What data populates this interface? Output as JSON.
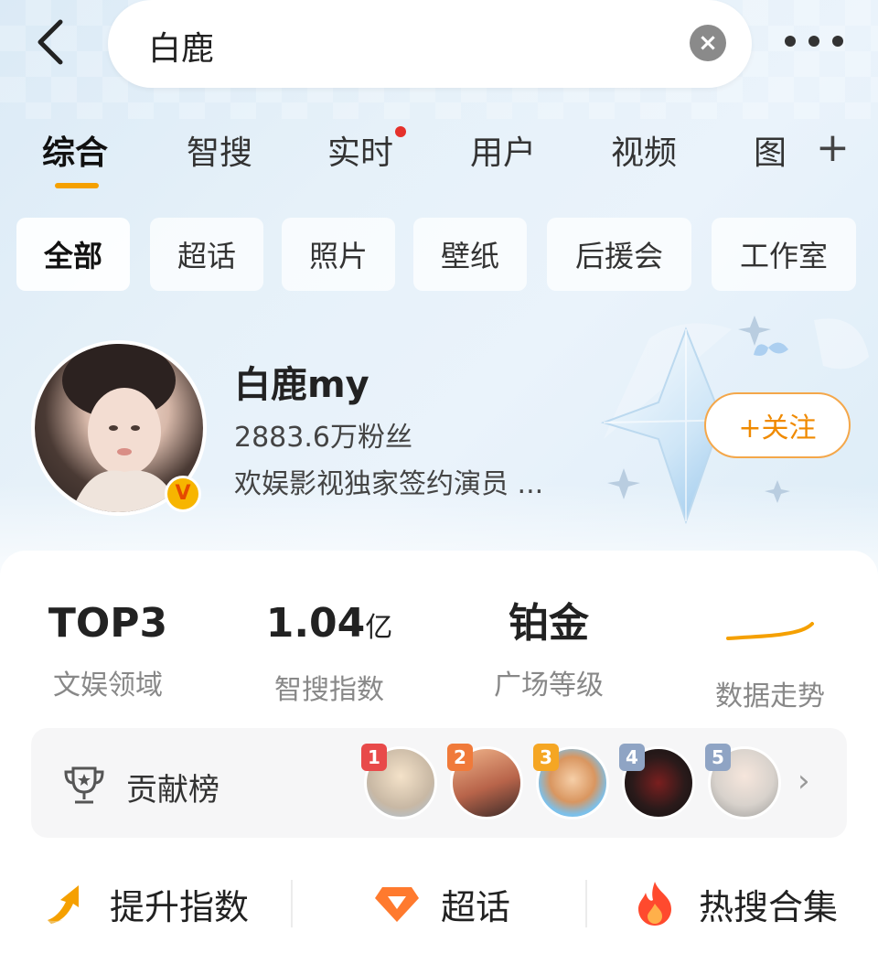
{
  "search": {
    "query": "白鹿",
    "clear_label": "×"
  },
  "tabs": [
    {
      "label": "综合"
    },
    {
      "label": "智搜"
    },
    {
      "label": "实时"
    },
    {
      "label": "用户"
    },
    {
      "label": "视频"
    },
    {
      "label": "图"
    }
  ],
  "plus_label": "+",
  "filters": [
    {
      "label": "全部"
    },
    {
      "label": "超话"
    },
    {
      "label": "照片"
    },
    {
      "label": "壁纸"
    },
    {
      "label": "后援会"
    },
    {
      "label": "工作室"
    }
  ],
  "profile": {
    "name": "白鹿my",
    "fans": "2883.6万粉丝",
    "description": "欢娱影视独家签约演员 ...",
    "verify_badge": "V",
    "follow_label": "+关注"
  },
  "stats": [
    {
      "value": "TOP3",
      "unit": "",
      "label": "文娱领域"
    },
    {
      "value": "1.04",
      "unit": "亿",
      "label": "智搜指数"
    },
    {
      "value": "铂金",
      "unit": "",
      "label": "广场等级"
    },
    {
      "value": "",
      "unit": "",
      "label": "数据走势"
    }
  ],
  "contribution": {
    "title": "贡献榜",
    "ranks": [
      {
        "num": "1",
        "color": "#e84a4a"
      },
      {
        "num": "2",
        "color": "#f07a3a"
      },
      {
        "num": "3",
        "color": "#f5a623"
      },
      {
        "num": "4",
        "color": "#8fa4c4"
      },
      {
        "num": "5",
        "color": "#8fa4c4"
      }
    ]
  },
  "actions": [
    {
      "label": "提升指数",
      "icon": "arrow-up-icon"
    },
    {
      "label": "超话",
      "icon": "diamond-icon"
    },
    {
      "label": "热搜合集",
      "icon": "flame-icon"
    }
  ],
  "accent_color": "#f5a000"
}
